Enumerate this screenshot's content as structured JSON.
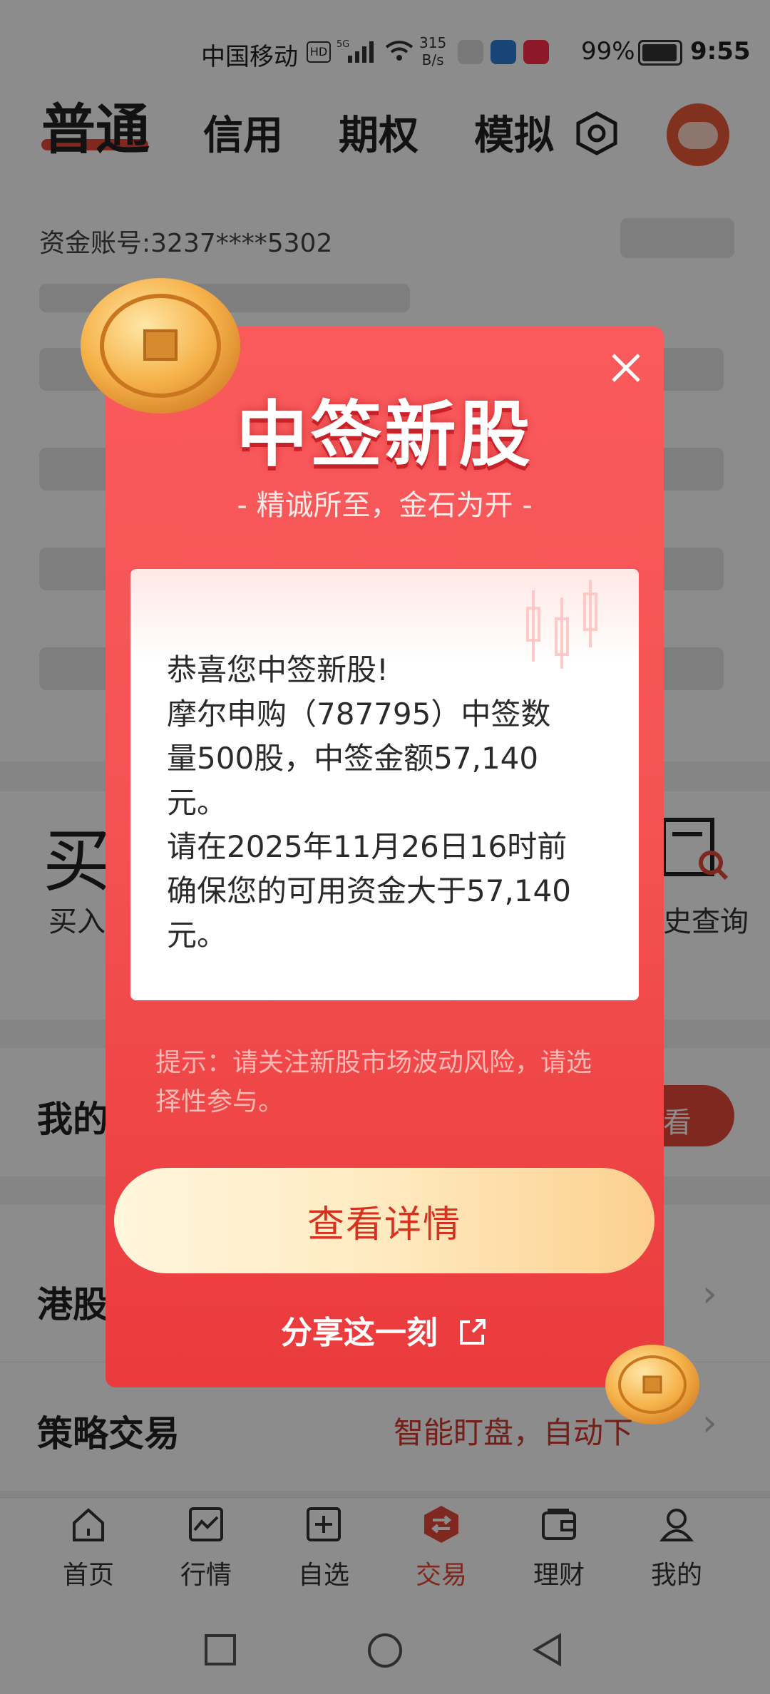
{
  "status_bar": {
    "carrier": "中国移动",
    "net_speed_value": "315",
    "net_speed_unit": "B/s",
    "battery": "99%",
    "time": "9:55"
  },
  "header": {
    "tabs": [
      "普通",
      "信用",
      "期权",
      "模拟"
    ]
  },
  "account": {
    "label": "资金账号:3237****5302"
  },
  "quick_actions": {
    "buy_glyph": "买",
    "buy_label": "买入",
    "history_label": "史查询"
  },
  "sections": {
    "my_partial": "我的",
    "view_partial": "看",
    "hk": "港股",
    "strategy": "策略交易",
    "strategy_sub": "智能盯盘，自动下"
  },
  "bottom_nav": [
    {
      "label": "首页",
      "icon": "home-icon"
    },
    {
      "label": "行情",
      "icon": "market-chart-icon"
    },
    {
      "label": "自选",
      "icon": "add-watchlist-icon"
    },
    {
      "label": "交易",
      "icon": "trade-exchange-icon"
    },
    {
      "label": "理财",
      "icon": "wallet-icon"
    },
    {
      "label": "我的",
      "icon": "profile-icon"
    }
  ],
  "modal": {
    "title": "中签新股",
    "subtitle": "- 精诚所至，金石为开 -",
    "lines": [
      "恭喜您中签新股!",
      "摩尔申购（787795）中签数",
      "量500股，中签金额57,140",
      "元。",
      "请在2025年11月26日16时前",
      "确保您的可用资金大于57,140",
      "元。"
    ],
    "tip": "提示：请关注新股市场波动风险，请选择性参与。",
    "detail_button": "查看详情",
    "share": "分享这一刻"
  },
  "colors": {
    "accent": "#e84a3a",
    "modal_red": "#f45354",
    "button_gold": "#fcd08f"
  }
}
